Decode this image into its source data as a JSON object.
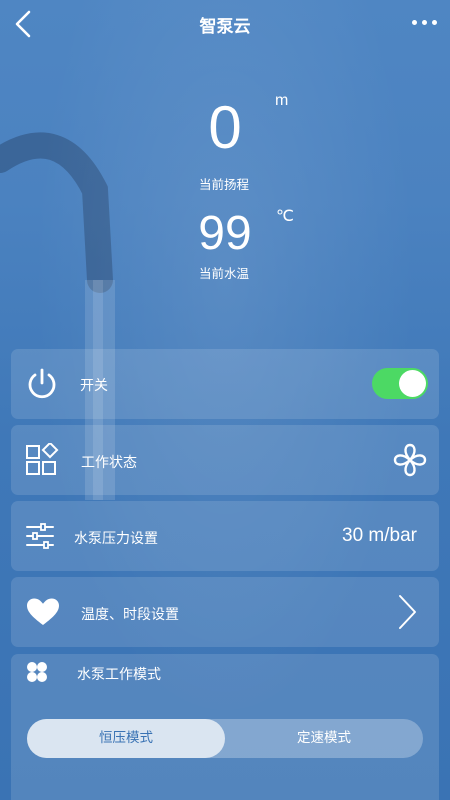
{
  "header": {
    "title": "智泵云"
  },
  "readings": {
    "head": {
      "value": "0",
      "unit": "m",
      "caption": "当前扬程"
    },
    "temp": {
      "value": "99",
      "unit": "℃",
      "caption": "当前水温"
    }
  },
  "cards": {
    "power": {
      "label": "开关",
      "toggle_on": true
    },
    "status": {
      "label": "工作状态"
    },
    "pressure": {
      "label": "水泵压力设置",
      "value": "30 m/bar"
    },
    "schedule": {
      "label": "温度、时段设置"
    },
    "mode": {
      "label": "水泵工作模式",
      "options": [
        "恒压模式",
        "定速模式"
      ],
      "selected": "恒压模式"
    }
  },
  "colors": {
    "toggle_on": "#4cd964",
    "background": "#4079b9"
  }
}
